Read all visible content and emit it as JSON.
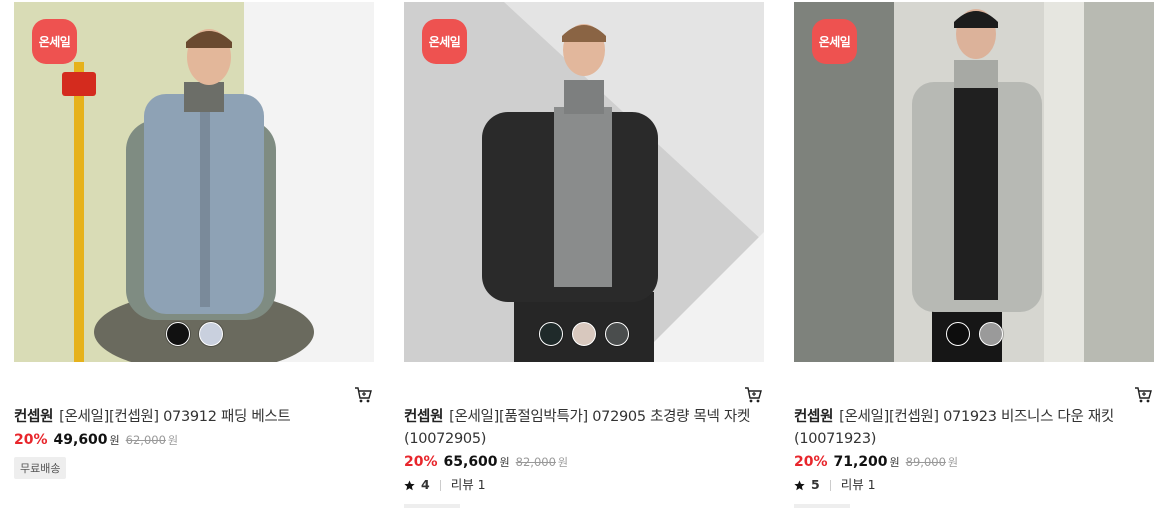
{
  "products": [
    {
      "badge": "온세일",
      "badge_color": "#ee5250",
      "swatches": [
        "#111111",
        "#c9d0de"
      ],
      "brand": "컨셉원",
      "name": "[온세일][컨셉원] 073912 패딩 베스트",
      "discount": "20%",
      "price": "49,600",
      "unit": "원",
      "original_price": "62,000",
      "original_unit": "원",
      "tag": "무료배송"
    },
    {
      "badge": "온세일",
      "badge_color": "#ee5250",
      "swatches": [
        "#1f2a2a",
        "#d8c8be",
        "#4a4d4d"
      ],
      "brand": "컨셉원",
      "name": "[온세일][품절임박특가] 072905 초경량 목넥 자켓 (10072905)",
      "discount": "20%",
      "price": "65,600",
      "unit": "원",
      "original_price": "82,000",
      "original_unit": "원",
      "rating": "4",
      "review": "리뷰 1"
    },
    {
      "badge": "온세일",
      "badge_color": "#ee5250",
      "swatches": [
        "#0d0d0d",
        "#9a9a9a"
      ],
      "brand": "컨셉원",
      "name": "[온세일][컨셉원] 071923 비즈니스 다운 재킷 (10071923)",
      "discount": "20%",
      "price": "71,200",
      "unit": "원",
      "original_price": "89,000",
      "original_unit": "원",
      "rating": "5",
      "review": "리뷰 1"
    }
  ],
  "icons": {
    "cart": "cart-icon",
    "star": "star-icon"
  }
}
